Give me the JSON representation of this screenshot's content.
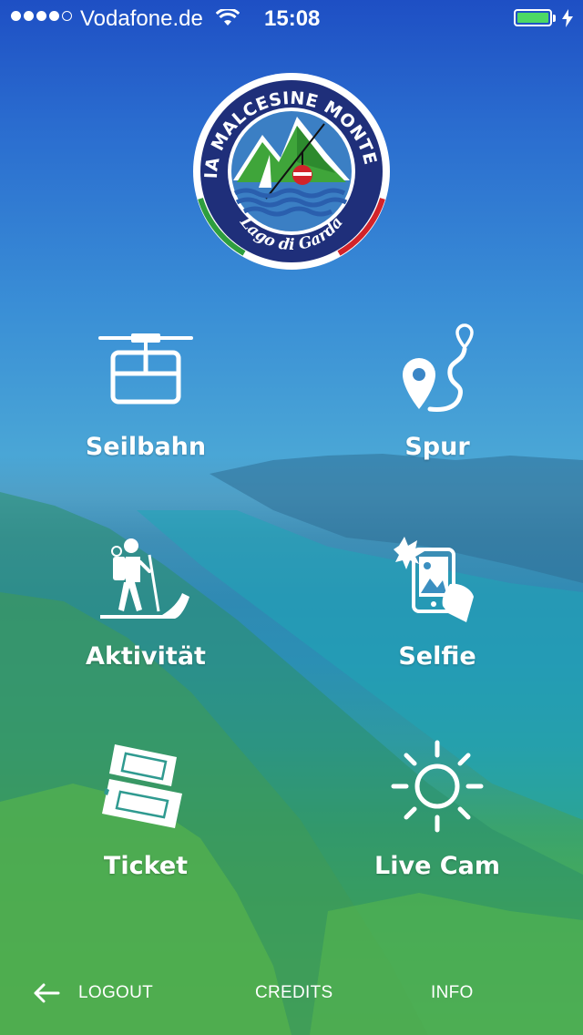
{
  "status_bar": {
    "carrier": "Vodafone.de",
    "time": "15:08",
    "signal_dots": 5,
    "signal_filled": 4,
    "battery_color": "#4cd964"
  },
  "logo": {
    "arc_top": "FUNIVIA MALCESINE MONTE BALDO",
    "arc_bottom": "Lago di Garda"
  },
  "menu": [
    {
      "label": "Seilbahn",
      "icon": "cable-car-icon"
    },
    {
      "label": "Spur",
      "icon": "route-pin-icon"
    },
    {
      "label": "Aktivität",
      "icon": "hiker-icon"
    },
    {
      "label": "Selfie",
      "icon": "phone-camera-icon"
    },
    {
      "label": "Ticket",
      "icon": "tickets-icon"
    },
    {
      "label": "Live Cam",
      "icon": "sun-icon"
    }
  ],
  "footer": {
    "logout": "LOGOUT",
    "credits": "CREDITS",
    "info": "INFO"
  }
}
